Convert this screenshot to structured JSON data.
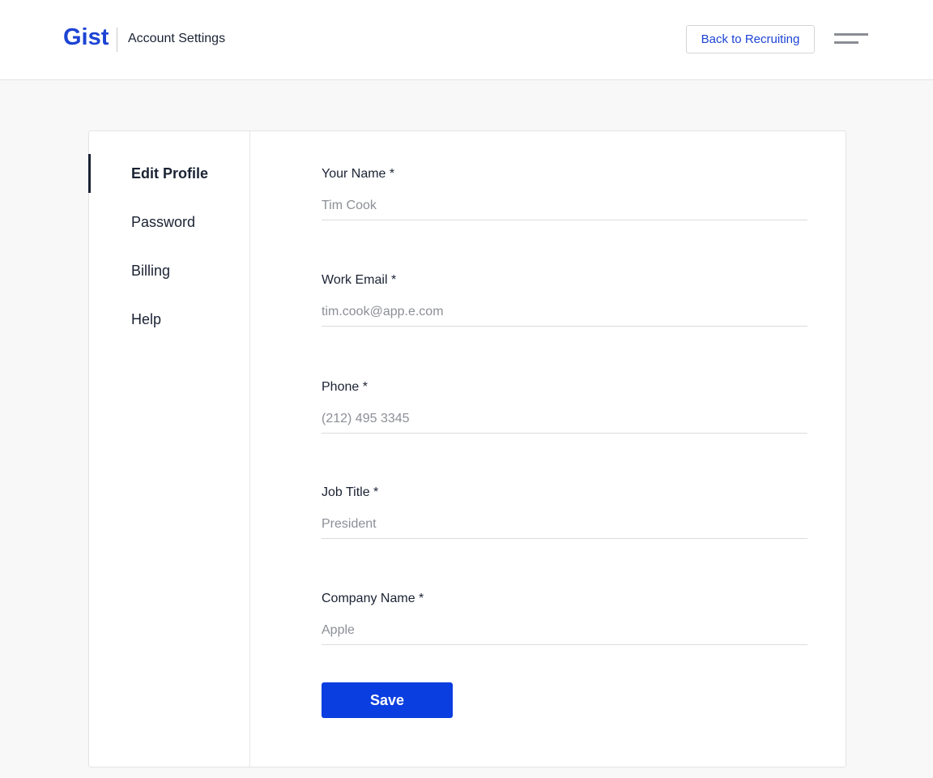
{
  "header": {
    "logo_text": "Gist",
    "title": "Account Settings",
    "back_button_label": "Back to Recruiting",
    "menu_icon": "hamburger-menu-icon",
    "brand_color": "#1d44d4"
  },
  "sidebar": {
    "items": [
      {
        "label": "Edit Profile",
        "active": true
      },
      {
        "label": "Password",
        "active": false
      },
      {
        "label": "Billing",
        "active": false
      },
      {
        "label": "Help",
        "active": false
      }
    ]
  },
  "form": {
    "fields": [
      {
        "label": "Your Name *",
        "value": "Tim Cook"
      },
      {
        "label": "Work Email *",
        "value": "tim.cook@app.e.com"
      },
      {
        "label": "Phone *",
        "value": "(212) 495 3345"
      },
      {
        "label": "Job Title *",
        "value": "President"
      },
      {
        "label": "Company Name *",
        "value": "Apple"
      }
    ],
    "save_label": "Save",
    "save_color": "#0a3ee0"
  }
}
